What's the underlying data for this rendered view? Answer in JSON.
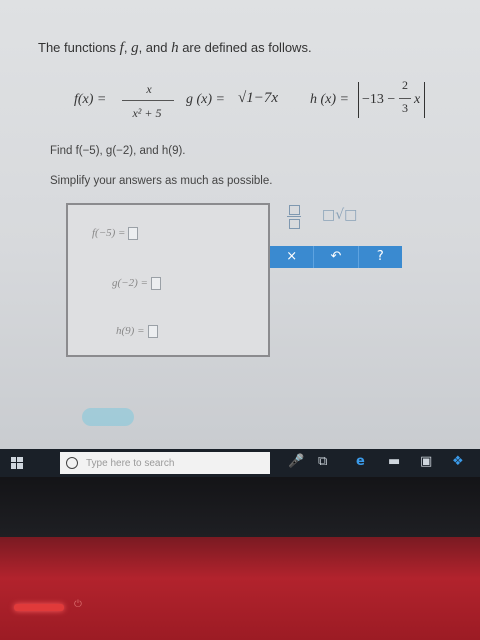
{
  "problem": {
    "title_prefix": "The functions ",
    "title_f": "f",
    "title_comma1": ", ",
    "title_g": "g",
    "title_and": ", and ",
    "title_h": "h",
    "title_suffix": " are defined as follows.",
    "f_lhs": "f(x) =",
    "f_num": "x",
    "f_den": "x² + 5",
    "g_lhs": "g (x) =",
    "g_rad": "√1−7x",
    "h_lhs": "h (x) =",
    "h_const": "−13 −",
    "h_num": "2",
    "h_den": "3",
    "h_var": "x",
    "find_text": "Find f(−5), g(−2), and h(9).",
    "simplify_text": "Simplify your answers as much as possible."
  },
  "answers": [
    {
      "label": "f(−5) ="
    },
    {
      "label": "g(−2) ="
    },
    {
      "label": "h(9) ="
    }
  ],
  "toolbar": {
    "fraction_icon": "fraction-icon",
    "sqrt_label": "□√□",
    "buttons": [
      "×",
      "↶",
      "?"
    ]
  },
  "taskbar": {
    "search_placeholder": "Type here to search"
  },
  "colors": {
    "toolbar_blue": "#3a8ad0",
    "laptop_red": "#b2232d"
  }
}
